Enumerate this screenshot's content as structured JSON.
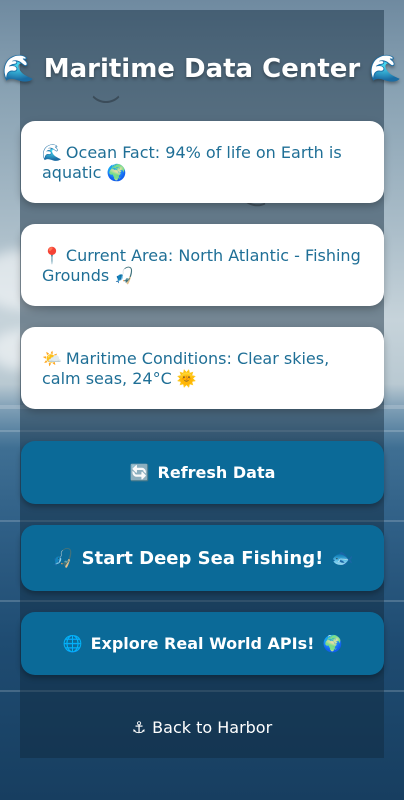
{
  "header": {
    "title": "Maritime Data Center",
    "icon_left": "🌊",
    "icon_right": "🌊"
  },
  "cards": [
    {
      "icon": "🌊",
      "text": "Ocean Fact: 94% of life on Earth is aquatic",
      "icon_after": "🌍"
    },
    {
      "icon": "📍",
      "text": "Current Area: North Atlantic - Fishing Grounds",
      "icon_after": "🎣"
    },
    {
      "icon": "🌤️",
      "text": "Maritime Conditions: Clear skies, calm seas, 24°C",
      "icon_after": "🌞"
    }
  ],
  "buttons": {
    "refresh": {
      "icon": "🔄",
      "label": "Refresh Data"
    },
    "fishing": {
      "icon": "🎣",
      "label": "Start Deep Sea Fishing!",
      "icon_after": "🐟"
    },
    "apis": {
      "icon": "🌐",
      "label": "Explore Real World APIs!",
      "icon_after": "🌍"
    }
  },
  "back_link": {
    "icon": "⚓",
    "label": "Back to Harbor"
  },
  "colors": {
    "button_bg": "#0b6a98",
    "card_text": "#1f6f96",
    "card_bg": "#ffffff"
  }
}
